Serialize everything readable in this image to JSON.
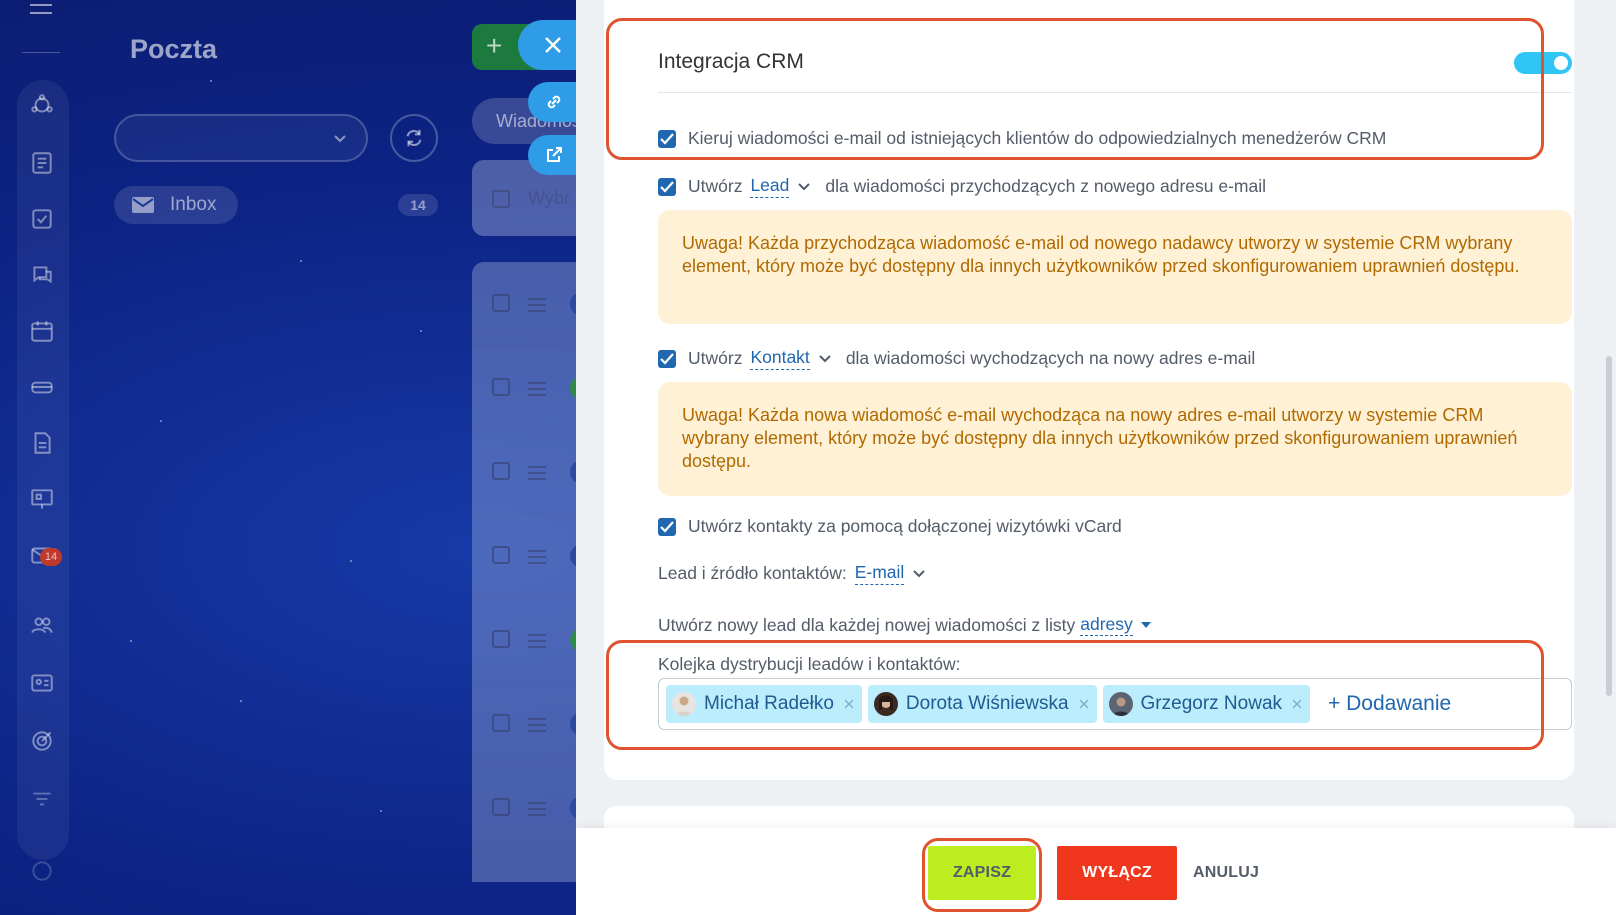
{
  "app": {
    "title": "Poczta",
    "inbox_label": "Inbox",
    "inbox_count": "14",
    "nav_badge": "14",
    "add_label": "+",
    "tab_label": "Wiadomości",
    "list_header_placeholder": "Wybr"
  },
  "crm": {
    "section_title": "Integracja CRM",
    "toggle_on": true,
    "route_existing": "Kieruj wiadomości e-mail od istniejących klientów do odpowiedzialnych menedżerów CRM",
    "incoming": {
      "prefix": "Utwórz",
      "entity": "Lead",
      "suffix": "dla wiadomości przychodzących z nowego adresu e-mail",
      "warning": "Uwaga! Każda przychodząca wiadomość e-mail od nowego nadawcy utworzy w systemie CRM wybrany element, który może być dostępny dla innych użytkowników przed skonfigurowaniem uprawnień dostępu."
    },
    "outgoing": {
      "prefix": "Utwórz",
      "entity": "Kontakt",
      "suffix": "dla wiadomości wychodzących na nowy adres e-mail",
      "warning": "Uwaga! Każda nowa wiadomość e-mail wychodząca na nowy adres e-mail utworzy w systemie CRM wybrany element, który może być dostępny dla innych użytkowników przed skonfigurowaniem uprawnień dostępu."
    },
    "vcard": "Utwórz kontakty za pomocą dołączonej wizytówki vCard",
    "source_label": "Lead i źródło kontaktów:",
    "source_value": "E-mail",
    "new_lead_label": "Utwórz nowy lead dla każdej nowej wiadomości z listy",
    "new_lead_value": "adresy",
    "queue_label": "Kolejka dystrybucji leadów i kontaktów:",
    "queue": [
      {
        "name": "Michał Radełko"
      },
      {
        "name": "Dorota Wiśniewska"
      },
      {
        "name": "Grzegorz Nowak"
      }
    ],
    "add_label": "+ Dodawanie"
  },
  "footer": {
    "save": "ZAPISZ",
    "disable": "WYŁĄCZ",
    "cancel": "ANULUJ"
  },
  "colors": {
    "accent": "#2067b0",
    "toggle": "#2fc6f6",
    "save": "#bbed21",
    "disable": "#f0371e",
    "highlight": "#e0532f",
    "warning_bg": "#fff1d6",
    "warning_text": "#b06a00"
  }
}
